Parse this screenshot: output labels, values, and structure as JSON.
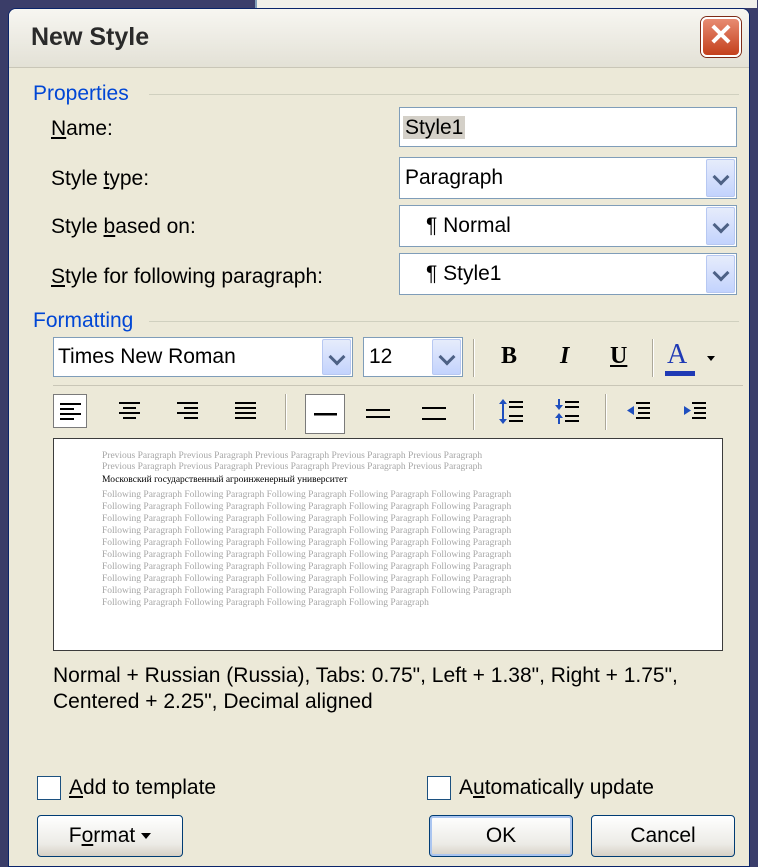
{
  "window": {
    "title": "New Style",
    "close_glyph": "✕"
  },
  "properties": {
    "section_label": "Properties",
    "name_label": "Name:",
    "name_value": "Style1",
    "style_type_label": "Style type:",
    "style_type_value": "Paragraph",
    "based_on_label": "Style based on:",
    "based_on_value": "¶ Normal",
    "following_label": "Style for following paragraph:",
    "following_value": "¶ Style1"
  },
  "formatting": {
    "section_label": "Formatting",
    "font_value": "Times New Roman",
    "size_value": "12",
    "bold_glyph": "B",
    "italic_glyph": "I",
    "underline_glyph": "U",
    "font_color_glyph": "A",
    "font_color": "#1f3ab5"
  },
  "preview": {
    "previous_lines": [
      "Previous Paragraph Previous Paragraph Previous Paragraph Previous Paragraph Previous Paragraph",
      "Previous Paragraph Previous Paragraph Previous Paragraph Previous Paragraph Previous Paragraph"
    ],
    "current_line": "Московский государственный агроинженерный университет",
    "following_lines": [
      "Following Paragraph Following Paragraph Following Paragraph Following Paragraph Following Paragraph",
      "Following Paragraph Following Paragraph Following Paragraph Following Paragraph Following Paragraph",
      "Following Paragraph Following Paragraph Following Paragraph Following Paragraph Following Paragraph",
      "Following Paragraph Following Paragraph Following Paragraph Following Paragraph Following Paragraph",
      "Following Paragraph Following Paragraph Following Paragraph Following Paragraph Following Paragraph",
      "Following Paragraph Following Paragraph Following Paragraph Following Paragraph Following Paragraph",
      "Following Paragraph Following Paragraph Following Paragraph Following Paragraph Following Paragraph",
      "Following Paragraph Following Paragraph Following Paragraph Following Paragraph Following Paragraph",
      "Following Paragraph Following Paragraph Following Paragraph Following Paragraph Following Paragraph",
      "Following Paragraph Following Paragraph Following Paragraph Following Paragraph"
    ]
  },
  "description": {
    "line1": "Normal + Russian (Russia), Tabs:  0.75\", Left +  1.38\", Right +  1.75\",",
    "line2": "Centered +  2.25\", Decimal aligned"
  },
  "options": {
    "add_to_template_label": "Add to template",
    "add_to_template_checked": false,
    "auto_update_label": "Automatically update",
    "auto_update_checked": false
  },
  "buttons": {
    "format_label": "Format",
    "ok_label": "OK",
    "cancel_label": "Cancel"
  }
}
